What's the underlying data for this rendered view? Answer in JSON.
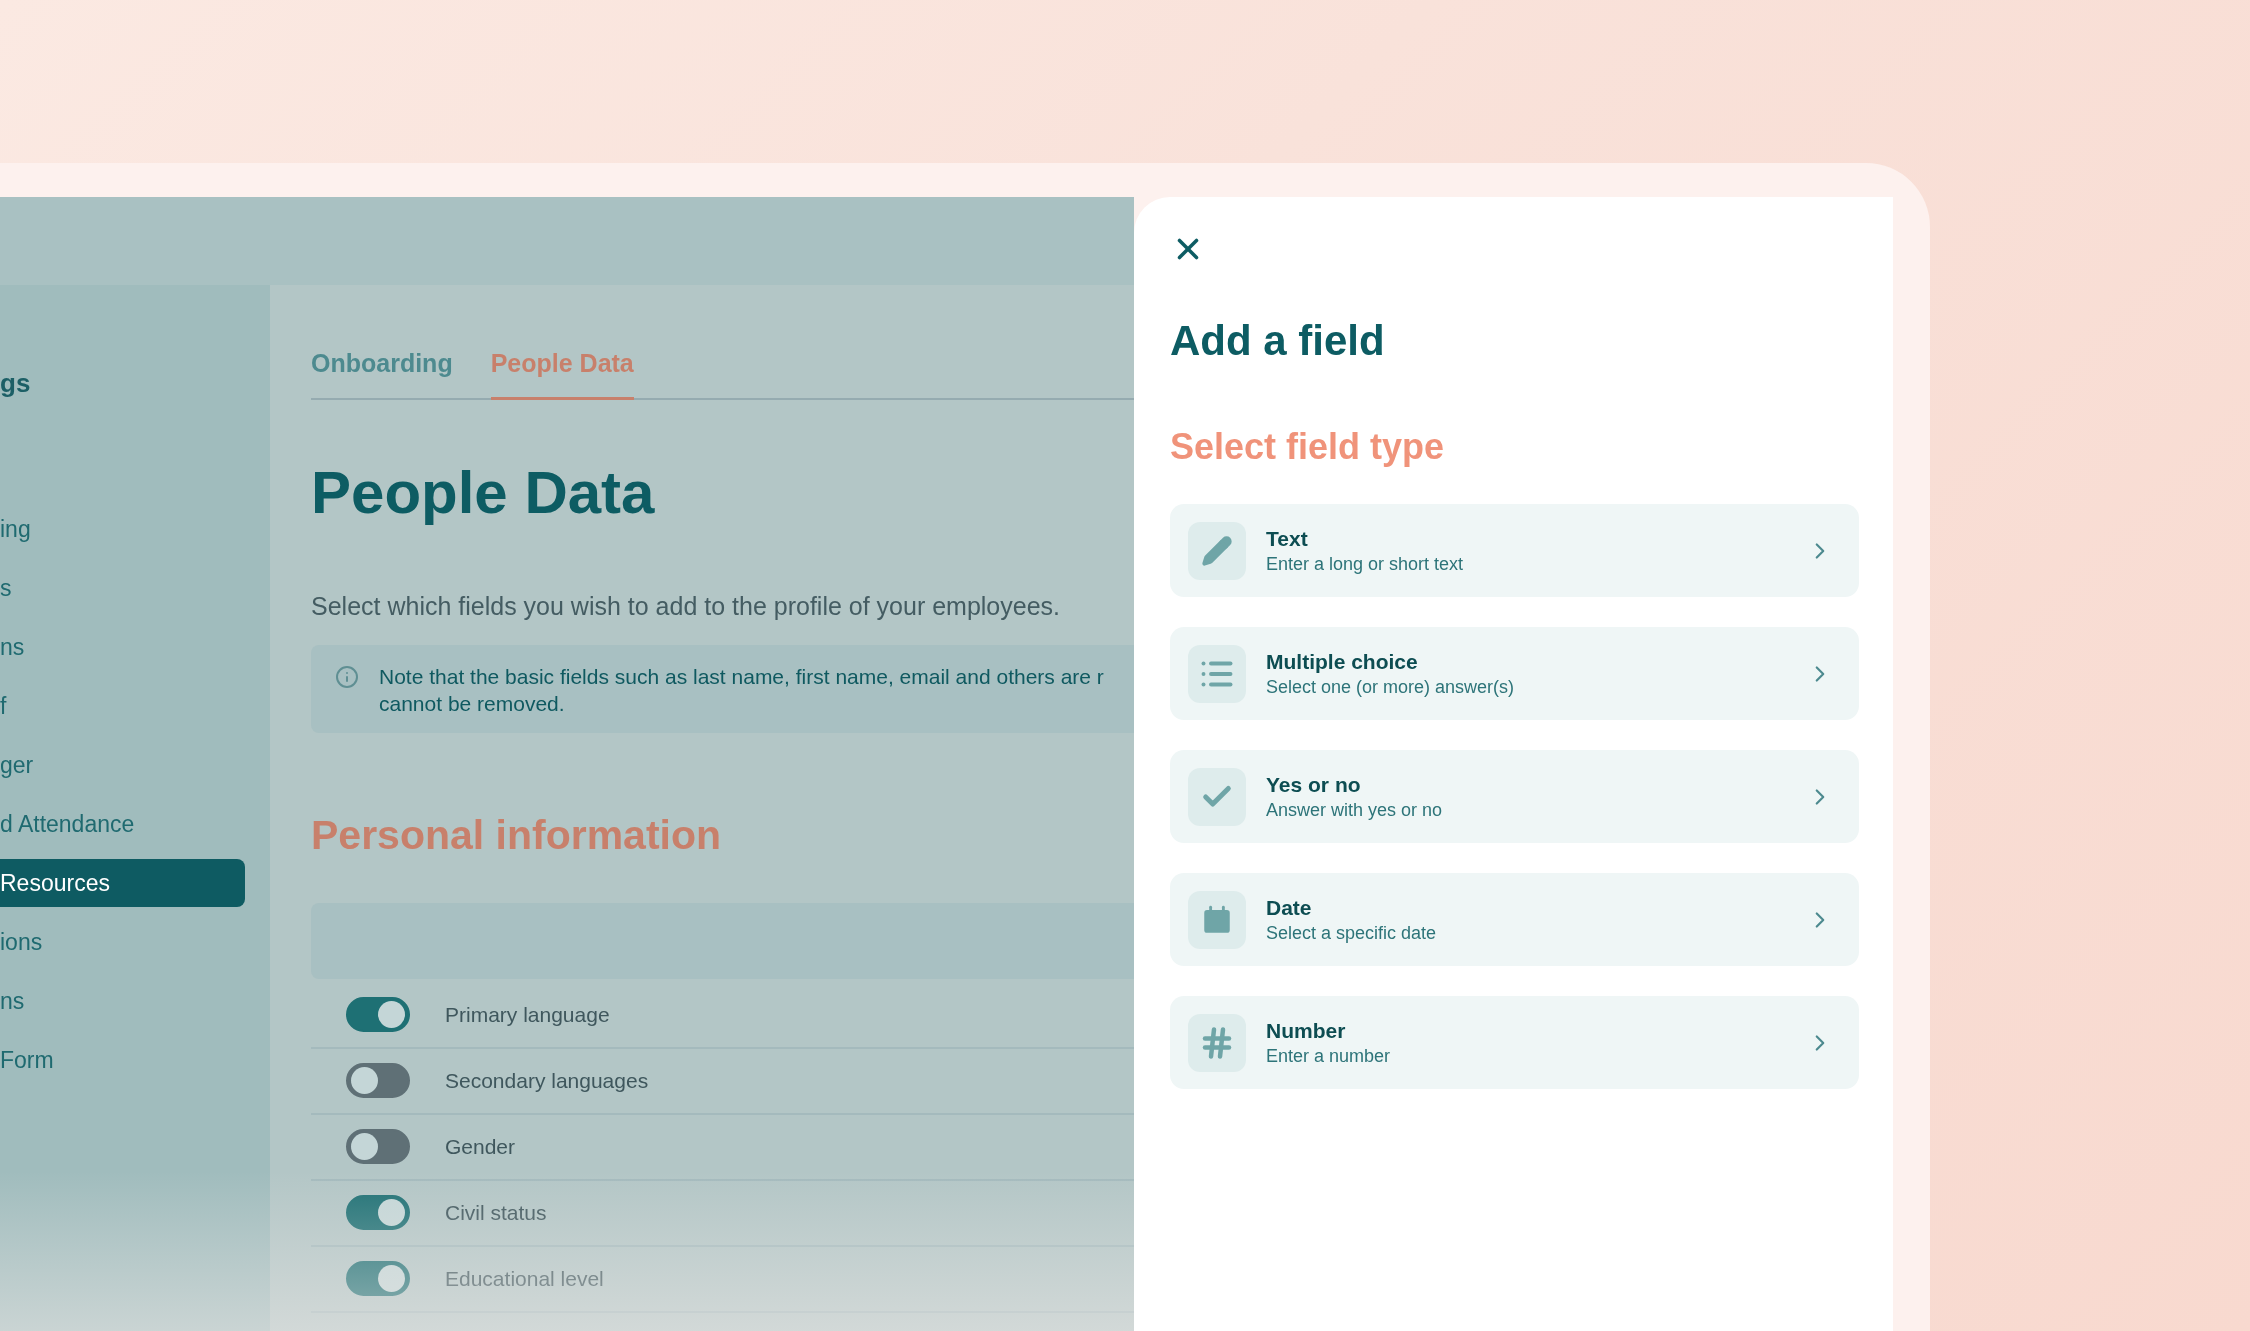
{
  "sidebar": {
    "heading": "gs",
    "items": [
      {
        "label": "ing",
        "selected": false
      },
      {
        "label": "s",
        "selected": false
      },
      {
        "label": "ns",
        "selected": false
      },
      {
        "label": "f",
        "selected": false
      },
      {
        "label": "ger",
        "selected": false
      },
      {
        "label": "d Attendance",
        "selected": false
      },
      {
        "label": "Resources",
        "selected": true
      },
      {
        "label": "ions",
        "selected": false
      },
      {
        "label": "ns",
        "selected": false
      },
      {
        "label": "Form",
        "selected": false
      }
    ]
  },
  "tabs": [
    {
      "label": "Onboarding",
      "selected": false
    },
    {
      "label": "People Data",
      "selected": true
    }
  ],
  "page_title": "People Data",
  "description": "Select which fields you wish to add to the profile of your employees.",
  "note_lines": [
    "Note that the basic fields such as last name, first name, email and others are r",
    "cannot be removed."
  ],
  "section_title": "Personal information",
  "fields": [
    {
      "label": "Primary language",
      "on": true
    },
    {
      "label": "Secondary languages",
      "on": false
    },
    {
      "label": "Gender",
      "on": false
    },
    {
      "label": "Civil status",
      "on": true
    },
    {
      "label": "Educational level",
      "on": true
    }
  ],
  "modal": {
    "title": "Add a field",
    "subtitle": "Select field type",
    "options": [
      {
        "kind": "text",
        "title": "Text",
        "description": "Enter a long or short text"
      },
      {
        "kind": "choice",
        "title": "Multiple choice",
        "description": "Select one (or more) answer(s)"
      },
      {
        "kind": "boolean",
        "title": "Yes or no",
        "description": "Answer with yes or no"
      },
      {
        "kind": "date",
        "title": "Date",
        "description": "Select a specific date"
      },
      {
        "kind": "number",
        "title": "Number",
        "description": "Enter a number"
      }
    ]
  }
}
